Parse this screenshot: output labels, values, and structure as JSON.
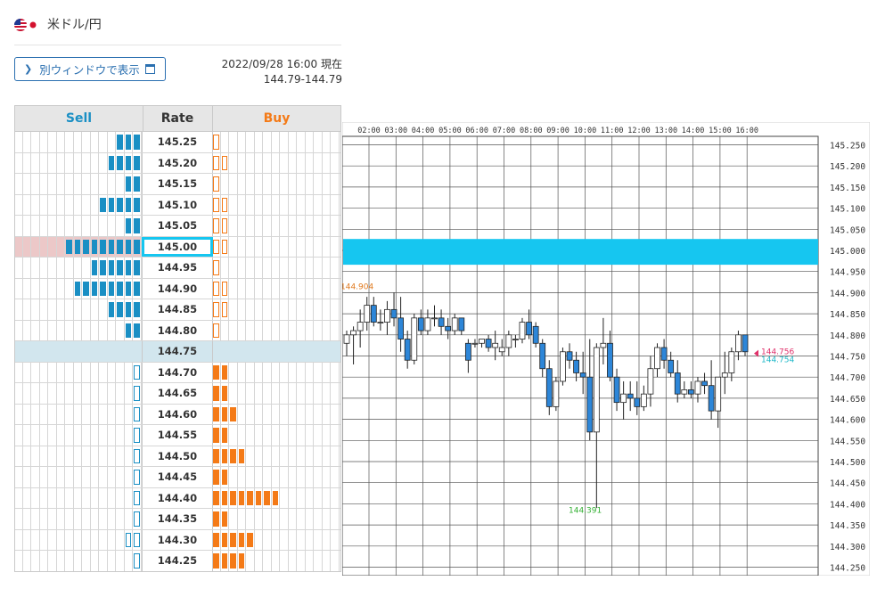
{
  "header": {
    "pair_label": "米ドル/円",
    "flag_icons": [
      "us-flag-icon",
      "jp-flag-icon"
    ]
  },
  "popup_button": {
    "label": "別ウィンドウで表示"
  },
  "timestamp": {
    "line1": "2022/09/28 16:00 現在",
    "line2": "144.79-144.79"
  },
  "orderbook": {
    "headers": {
      "sell": "Sell",
      "rate": "Rate",
      "buy": "Buy"
    },
    "colors": {
      "sell": "#1a8fc4",
      "buy": "#f47a17",
      "current_row": "#d2e6ee",
      "highlight_row": "#ecc8c8",
      "cyan": "#16c6f0"
    },
    "current_rate": "144.75",
    "highlight_rate": "145.00",
    "rows": [
      {
        "rate": "145.25",
        "sell": 3,
        "buy": 1,
        "buy_outline": true
      },
      {
        "rate": "145.20",
        "sell": 4,
        "buy": 2,
        "buy_outline": true
      },
      {
        "rate": "145.15",
        "sell": 2,
        "buy": 1,
        "buy_outline": true
      },
      {
        "rate": "145.10",
        "sell": 5,
        "buy": 2,
        "buy_outline": true
      },
      {
        "rate": "145.05",
        "sell": 2,
        "buy": 2,
        "buy_outline": true
      },
      {
        "rate": "145.00",
        "sell": 9,
        "buy": 2,
        "buy_outline": true
      },
      {
        "rate": "144.95",
        "sell": 6,
        "buy": 1,
        "buy_outline": true
      },
      {
        "rate": "144.90",
        "sell": 8,
        "buy": 2,
        "buy_outline": true
      },
      {
        "rate": "144.85",
        "sell": 4,
        "buy": 2,
        "buy_outline": true
      },
      {
        "rate": "144.80",
        "sell": 2,
        "buy": 1,
        "buy_outline": true
      },
      {
        "rate": "144.75",
        "sell": 0,
        "buy": 0
      },
      {
        "rate": "144.70",
        "sell": 1,
        "sell_outline": true,
        "buy": 2
      },
      {
        "rate": "144.65",
        "sell": 1,
        "sell_outline": true,
        "buy": 2
      },
      {
        "rate": "144.60",
        "sell": 1,
        "sell_outline": true,
        "buy": 3
      },
      {
        "rate": "144.55",
        "sell": 1,
        "sell_outline": true,
        "buy": 2
      },
      {
        "rate": "144.50",
        "sell": 1,
        "sell_outline": true,
        "buy": 4
      },
      {
        "rate": "144.45",
        "sell": 1,
        "sell_outline": true,
        "buy": 2
      },
      {
        "rate": "144.40",
        "sell": 1,
        "sell_outline": true,
        "buy": 8
      },
      {
        "rate": "144.35",
        "sell": 1,
        "sell_outline": true,
        "buy": 2
      },
      {
        "rate": "144.30",
        "sell": 2,
        "sell_outline": true,
        "buy": 5
      },
      {
        "rate": "144.25",
        "sell": 1,
        "sell_outline": true,
        "buy": 4
      }
    ]
  },
  "chart_data": {
    "type": "candlestick",
    "x_labels": [
      "02:00",
      "03:00",
      "04:00",
      "05:00",
      "06:00",
      "07:00",
      "08:00",
      "09:00",
      "10:00",
      "11:00",
      "12:00",
      "13:00",
      "14:00",
      "15:00",
      "16:00"
    ],
    "y_ticks": [
      "145.250",
      "145.200",
      "145.150",
      "145.100",
      "145.050",
      "145.000",
      "144.950",
      "144.900",
      "144.850",
      "144.800",
      "144.750",
      "144.700",
      "144.650",
      "144.600",
      "144.550",
      "144.500",
      "144.450",
      "144.400",
      "144.350",
      "144.300",
      "144.250"
    ],
    "ylim": [
      144.23,
      145.27
    ],
    "highlight_band": [
      144.985,
      145.008
    ],
    "annotations": {
      "left_high": "144.904",
      "low": "144.391",
      "price_a": "144.756",
      "price_b": "144.754"
    },
    "colors": {
      "up": "#ffffff",
      "down": "#2d86d8",
      "band": "#16c6f0",
      "low_label": "#33b033",
      "left_label": "#e07a1f",
      "price_a": "#e0306a",
      "price_b": "#1fb8c8"
    },
    "candles": [
      {
        "o": 144.78,
        "h": 144.81,
        "l": 144.75,
        "c": 144.8
      },
      {
        "o": 144.8,
        "h": 144.82,
        "l": 144.73,
        "c": 144.81
      },
      {
        "o": 144.81,
        "h": 144.86,
        "l": 144.77,
        "c": 144.83
      },
      {
        "o": 144.83,
        "h": 144.89,
        "l": 144.81,
        "c": 144.87
      },
      {
        "o": 144.87,
        "h": 144.89,
        "l": 144.82,
        "c": 144.83
      },
      {
        "o": 144.83,
        "h": 144.86,
        "l": 144.81,
        "c": 144.83
      },
      {
        "o": 144.83,
        "h": 144.88,
        "l": 144.8,
        "c": 144.86
      },
      {
        "o": 144.86,
        "h": 144.9,
        "l": 144.82,
        "c": 144.84
      },
      {
        "o": 144.84,
        "h": 144.89,
        "l": 144.76,
        "c": 144.79
      },
      {
        "o": 144.79,
        "h": 144.81,
        "l": 144.72,
        "c": 144.74
      },
      {
        "o": 144.74,
        "h": 144.85,
        "l": 144.73,
        "c": 144.84
      },
      {
        "o": 144.84,
        "h": 144.86,
        "l": 144.8,
        "c": 144.81
      },
      {
        "o": 144.81,
        "h": 144.86,
        "l": 144.8,
        "c": 144.84
      },
      {
        "o": 144.84,
        "h": 144.87,
        "l": 144.82,
        "c": 144.84
      },
      {
        "o": 144.84,
        "h": 144.86,
        "l": 144.8,
        "c": 144.82
      },
      {
        "o": 144.82,
        "h": 144.84,
        "l": 144.79,
        "c": 144.81
      },
      {
        "o": 144.81,
        "h": 144.85,
        "l": 144.8,
        "c": 144.84
      },
      {
        "o": 144.84,
        "h": 144.84,
        "l": 144.8,
        "c": 144.81
      },
      {
        "o": 144.78,
        "h": 144.79,
        "l": 144.71,
        "c": 144.74
      },
      {
        "o": 144.78,
        "h": 144.79,
        "l": 144.77,
        "c": 144.78
      },
      {
        "o": 144.78,
        "h": 144.79,
        "l": 144.77,
        "c": 144.79
      },
      {
        "o": 144.79,
        "h": 144.8,
        "l": 144.76,
        "c": 144.77
      },
      {
        "o": 144.77,
        "h": 144.81,
        "l": 144.74,
        "c": 144.78
      },
      {
        "o": 144.76,
        "h": 144.79,
        "l": 144.75,
        "c": 144.77
      },
      {
        "o": 144.77,
        "h": 144.81,
        "l": 144.75,
        "c": 144.8
      },
      {
        "o": 144.79,
        "h": 144.8,
        "l": 144.77,
        "c": 144.79
      },
      {
        "o": 144.79,
        "h": 144.84,
        "l": 144.78,
        "c": 144.83
      },
      {
        "o": 144.83,
        "h": 144.86,
        "l": 144.79,
        "c": 144.8
      },
      {
        "o": 144.82,
        "h": 144.83,
        "l": 144.77,
        "c": 144.78
      },
      {
        "o": 144.78,
        "h": 144.79,
        "l": 144.7,
        "c": 144.72
      },
      {
        "o": 144.72,
        "h": 144.74,
        "l": 144.61,
        "c": 144.63
      },
      {
        "o": 144.63,
        "h": 144.7,
        "l": 144.62,
        "c": 144.69
      },
      {
        "o": 144.69,
        "h": 144.77,
        "l": 144.68,
        "c": 144.76
      },
      {
        "o": 144.76,
        "h": 144.78,
        "l": 144.72,
        "c": 144.74
      },
      {
        "o": 144.74,
        "h": 144.76,
        "l": 144.69,
        "c": 144.71
      },
      {
        "o": 144.71,
        "h": 144.76,
        "l": 144.66,
        "c": 144.7
      },
      {
        "o": 144.7,
        "h": 144.79,
        "l": 144.55,
        "c": 144.57
      },
      {
        "o": 144.57,
        "h": 144.78,
        "l": 144.39,
        "c": 144.77
      },
      {
        "o": 144.77,
        "h": 144.84,
        "l": 144.73,
        "c": 144.78
      },
      {
        "o": 144.78,
        "h": 144.81,
        "l": 144.69,
        "c": 144.7
      },
      {
        "o": 144.7,
        "h": 144.72,
        "l": 144.62,
        "c": 144.64
      },
      {
        "o": 144.64,
        "h": 144.69,
        "l": 144.6,
        "c": 144.66
      },
      {
        "o": 144.66,
        "h": 144.69,
        "l": 144.62,
        "c": 144.65
      },
      {
        "o": 144.65,
        "h": 144.69,
        "l": 144.61,
        "c": 144.63
      },
      {
        "o": 144.63,
        "h": 144.68,
        "l": 144.62,
        "c": 144.66
      },
      {
        "o": 144.66,
        "h": 144.75,
        "l": 144.63,
        "c": 144.72
      },
      {
        "o": 144.72,
        "h": 144.78,
        "l": 144.7,
        "c": 144.77
      },
      {
        "o": 144.77,
        "h": 144.79,
        "l": 144.72,
        "c": 144.74
      },
      {
        "o": 144.74,
        "h": 144.76,
        "l": 144.7,
        "c": 144.71
      },
      {
        "o": 144.71,
        "h": 144.74,
        "l": 144.64,
        "c": 144.66
      },
      {
        "o": 144.66,
        "h": 144.69,
        "l": 144.65,
        "c": 144.67
      },
      {
        "o": 144.67,
        "h": 144.69,
        "l": 144.65,
        "c": 144.66
      },
      {
        "o": 144.66,
        "h": 144.7,
        "l": 144.64,
        "c": 144.69
      },
      {
        "o": 144.69,
        "h": 144.71,
        "l": 144.66,
        "c": 144.68
      },
      {
        "o": 144.68,
        "h": 144.74,
        "l": 144.6,
        "c": 144.62
      },
      {
        "o": 144.62,
        "h": 144.7,
        "l": 144.58,
        "c": 144.7
      },
      {
        "o": 144.7,
        "h": 144.76,
        "l": 144.66,
        "c": 144.71
      },
      {
        "o": 144.71,
        "h": 144.77,
        "l": 144.69,
        "c": 144.76
      },
      {
        "o": 144.76,
        "h": 144.81,
        "l": 144.74,
        "c": 144.8
      },
      {
        "o": 144.8,
        "h": 144.8,
        "l": 144.75,
        "c": 144.76
      }
    ]
  }
}
